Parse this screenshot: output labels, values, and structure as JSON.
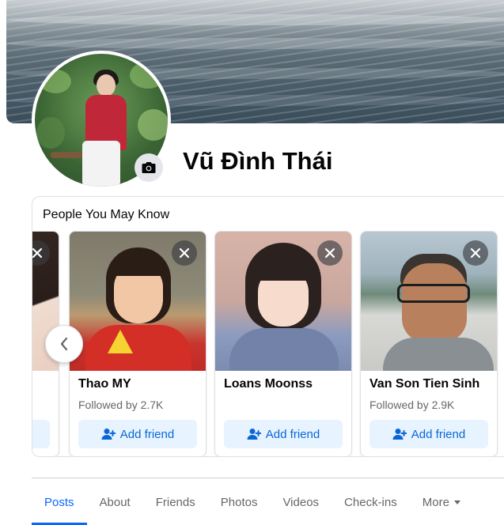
{
  "profile": {
    "name": "Vũ Đình Thái"
  },
  "pymk": {
    "title": "People You May Know",
    "cards": [
      {
        "name": "",
        "sub": "",
        "button": ""
      },
      {
        "name": "Thao MY",
        "sub": "Followed by 2.7K",
        "button": "Add friend"
      },
      {
        "name": "Loans Moonss",
        "sub": "",
        "button": "Add friend"
      },
      {
        "name": "Van Son Tien Sinh",
        "sub": "Followed by 2.9K",
        "button": "Add friend"
      }
    ]
  },
  "tabs": [
    {
      "label": "Posts",
      "active": true
    },
    {
      "label": "About"
    },
    {
      "label": "Friends"
    },
    {
      "label": "Photos"
    },
    {
      "label": "Videos"
    },
    {
      "label": "Check-ins"
    },
    {
      "label": "More"
    }
  ],
  "icons": {
    "camera": "camera-icon",
    "close": "close-icon",
    "add_friend": "add-friend-icon",
    "prev": "chevron-left-icon",
    "more_caret": "caret-down-icon"
  },
  "colors": {
    "accent": "#0866ff",
    "button_bg": "#e7f3ff",
    "button_text": "#0a66d8"
  }
}
